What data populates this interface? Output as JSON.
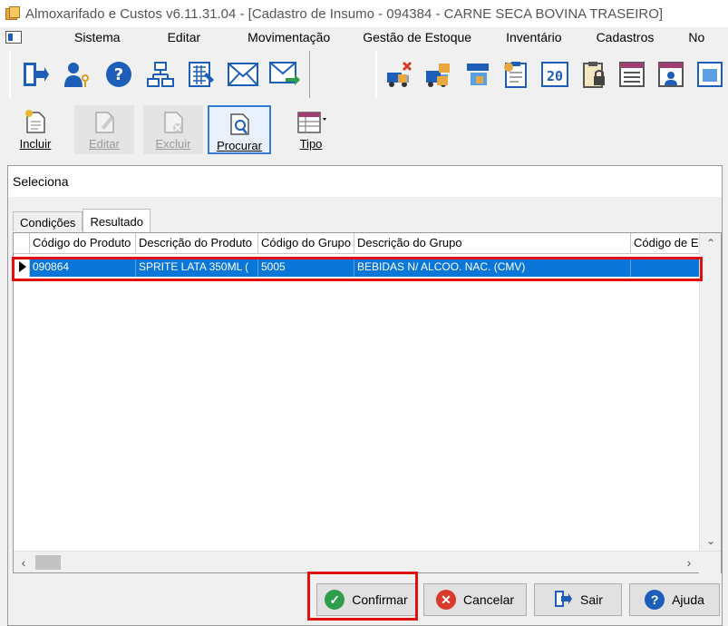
{
  "window": {
    "title": "Almoxarifado e Custos v6.11.31.04 - [Cadastro de Insumo - 094384 - CARNE SECA BOVINA TRASEIRO]"
  },
  "menu": {
    "items": [
      "Sistema",
      "Editar",
      "Movimentação",
      "Gestão de Estoque",
      "Inventário",
      "Cadastros",
      "No"
    ]
  },
  "toolbar": {
    "group1_icons": [
      "exit-icon",
      "user-key-icon",
      "help-icon",
      "org-chart-icon",
      "calculator-icon",
      "mail-icon",
      "mail-send-icon"
    ],
    "group2_icons": [
      "truck-cancel-icon",
      "truck-box-icon",
      "transfer-icon",
      "clipboard-star-icon",
      "counter-icon",
      "clipboard-lock-icon",
      "list-icon",
      "report-user-icon",
      "more-icon"
    ]
  },
  "actions": {
    "incluir": "Incluir",
    "editar": "Editar",
    "excluir": "Excluir",
    "procurar": "Procurar",
    "tipo": "Tipo"
  },
  "dialog": {
    "title": "Seleciona",
    "tabs": [
      "Condições",
      "Resultado"
    ],
    "active_tab": "Resultado",
    "columns": [
      "Código do Produto",
      "Descrição do Produto",
      "Código do Grupo",
      "Descrição do Grupo",
      "Código de E"
    ],
    "rows": [
      {
        "codigo_produto": "090864",
        "descricao_produto": "SPRITE LATA 350ML (",
        "codigo_grupo": "5005",
        "descricao_grupo": "BEBIDAS N/ ALCOO. NAC. (CMV)",
        "codigo_e": ""
      }
    ],
    "buttons": {
      "confirmar": "Confirmar",
      "cancelar": "Cancelar",
      "sair": "Sair",
      "ajuda": "Ajuda"
    }
  },
  "colors": {
    "selection": "#0a76d8",
    "highlight": "#e01010",
    "confirm_green": "#2e9e4a",
    "cancel_red": "#d83a2c",
    "help_blue": "#1d5fb8"
  }
}
